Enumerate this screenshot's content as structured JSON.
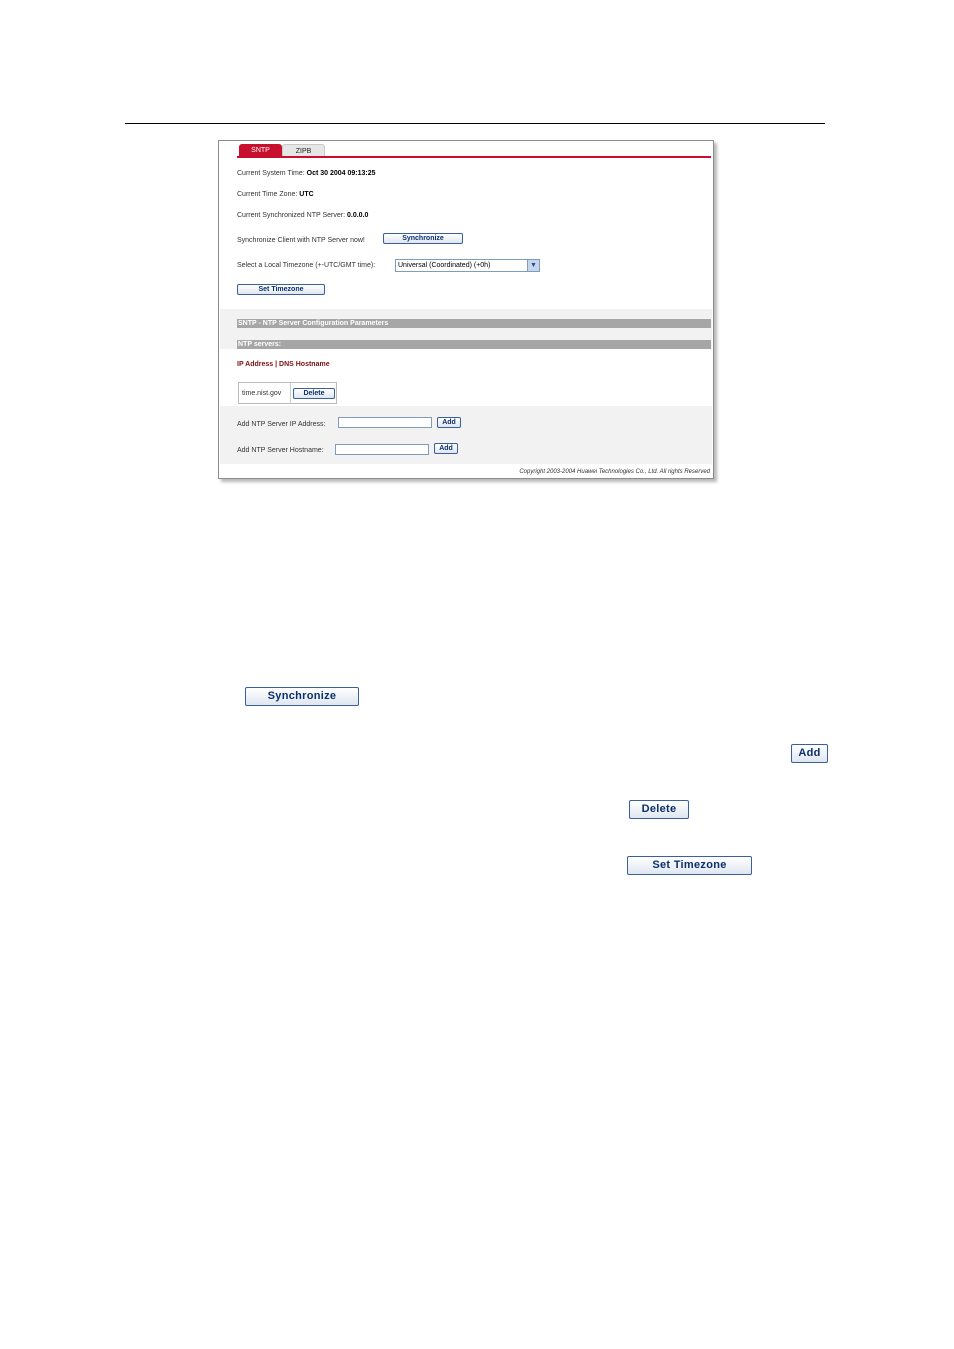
{
  "tabs": [
    {
      "label": "SNTP",
      "active": true
    },
    {
      "label": "ZIPB",
      "active": false
    }
  ],
  "status": {
    "system_time_label": "Current System Time:",
    "system_time_value": "Oct 30 2004 09:13:25",
    "time_zone_label": "Current Time Zone:",
    "time_zone_value": "UTC",
    "ntp_server_label": "Current Synchronized NTP Server:",
    "ntp_server_value": "0.0.0.0"
  },
  "sync": {
    "label": "Synchronize Client with NTP Server now!",
    "button": "Synchronize"
  },
  "timezone": {
    "label": "Select a Local Timezone (+-UTC/GMT time):",
    "selected": "Universal (Coordinated) (+0h)",
    "button": "Set Timezone"
  },
  "sections": {
    "config_header": "SNTP - NTP Server Configuration Parameters",
    "servers_header": "NTP servers:",
    "column_header": "IP Address | DNS Hostname"
  },
  "servers": [
    {
      "name": "time.nist.gov",
      "delete_label": "Delete"
    }
  ],
  "add_ip": {
    "label": "Add NTP Server IP Address:",
    "button": "Add"
  },
  "add_host": {
    "label": "Add NTP Server Hostname:",
    "button": "Add"
  },
  "footer": {
    "copyright": "Copyright 2003-2004 Huawei Technologies Co., Ltd. All rights Reserved"
  },
  "legend_buttons": {
    "synchronize": "Synchronize",
    "add": "Add",
    "delete": "Delete",
    "set_timezone": "Set Timezone"
  },
  "colors": {
    "accent": "#c8102e",
    "section_bar": "#a6a6a6",
    "button_text": "#0b2f6b"
  }
}
